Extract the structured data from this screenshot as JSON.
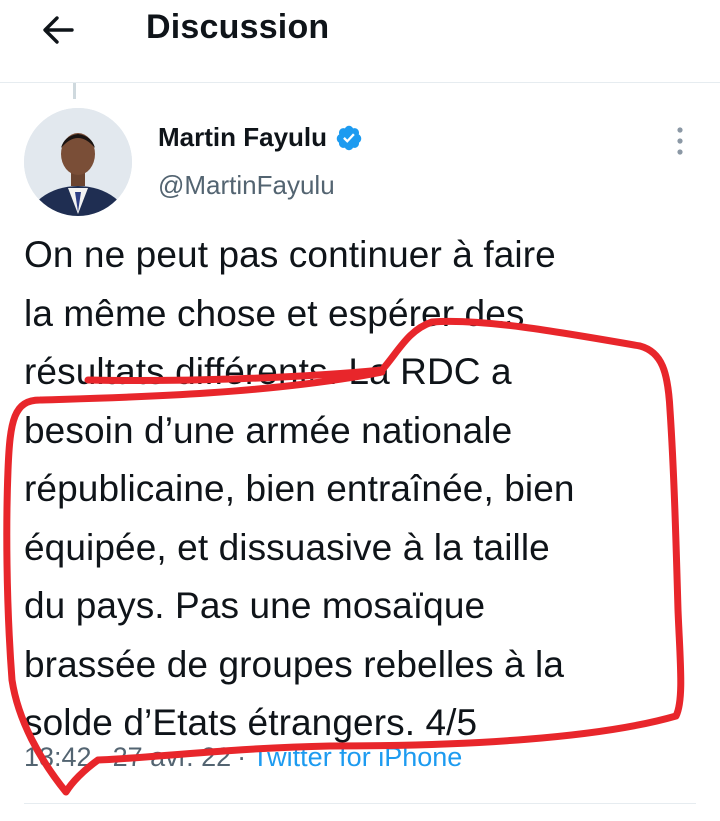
{
  "header": {
    "title": "Discussion"
  },
  "tweet": {
    "author": {
      "name": "Martin Fayulu",
      "handle": "@MartinFayulu",
      "verified": true
    },
    "text": "On ne peut pas continuer à faire\nla même chose et espérer des\nrésultats différents. La RDC a\nbesoin d’une armée nationale\nrépublicaine, bien entraînée, bien\néquipée, et dissuasive à la taille\ndu pays. Pas une mosaïque\nbrassée de groupes rebelles à la\nsolde d’Etats étrangers. 4/5",
    "meta": {
      "time": "13:42",
      "separator1": "·",
      "date": "27 avr. 22",
      "separator2": "·",
      "source": "Twitter for iPhone"
    }
  },
  "colors": {
    "accent": "#1d9bf0",
    "annotation": "#e8262b",
    "muted": "#536471"
  },
  "icons": {
    "back": "arrow-left-icon",
    "verified": "verified-badge-icon",
    "more": "more-vertical-icon"
  }
}
